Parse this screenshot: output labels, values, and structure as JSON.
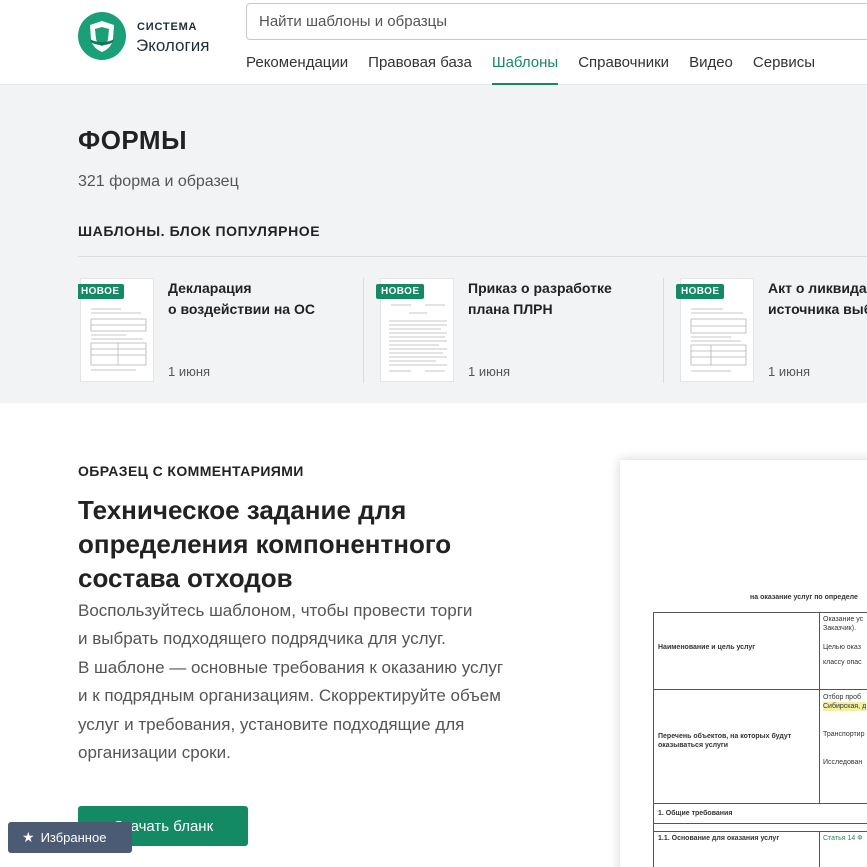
{
  "header": {
    "logo_small": "СИСТЕМА",
    "logo_big": "Экология",
    "search_placeholder": "Найти шаблоны и образцы",
    "nav": [
      "Рекомендации",
      "Правовая база",
      "Шаблоны",
      "Справочники",
      "Видео",
      "Сервисы"
    ],
    "active_nav": "Шаблоны"
  },
  "forms": {
    "title": "ФОРМЫ",
    "count": "321 форма и образец",
    "block_title": "ШАБЛОНЫ. БЛОК ПОПУЛЯРНОЕ",
    "cards": [
      {
        "badge": "НОВОЕ",
        "title_line1": "Декларация",
        "title_line2": "о воздействии на ОС",
        "date": "1 июня"
      },
      {
        "badge": "НОВОЕ",
        "title_line1": "Приказ о разработке",
        "title_line2": "плана ПЛРН",
        "date": "1 июня"
      },
      {
        "badge": "НОВОЕ",
        "title_line1": "Акт о ликвидации",
        "title_line2": "источника выбросов",
        "date": "1 июня"
      }
    ]
  },
  "sample": {
    "label": "ОБРАЗЕЦ С КОММЕНТАРИЯМИ",
    "title_lines": [
      "Техническое задание для",
      "определения компонентного",
      "состава отходов"
    ],
    "desc_lines": [
      "Воспользуйтесь шаблоном, чтобы провести торги",
      "и выбрать подходящего подрядчика для услуг.",
      "В шаблоне — основные требования к оказанию услуг",
      "и к подрядным организациям. Скорректируйте объем",
      "услуг и требования, установите подходящие для",
      "организации сроки."
    ],
    "download_label": "Скачать бланк"
  },
  "favorites_label": "Избранное",
  "preview": {
    "heading": "на оказание услуг по определе",
    "row1_label": "Наименование и цель услуг",
    "row1_value_a": "Оказание ус",
    "row1_value_b": "Заказчик).",
    "row1_value_c": "Целью оказ",
    "row1_value_d": "классу опас",
    "row2_label_a": "Перечень объектов, на которых будут",
    "row2_label_b": "оказываться услуги",
    "row2_value_a": "Отбор проб",
    "row2_value_b": "Сибирская, д",
    "row2_value_c": "Транспортир",
    "row2_value_d": "Исследован",
    "row3_label": "1. Общие требования",
    "row4_label": "1.1. Основание для оказания услуг",
    "row4_value": "Статья 14 Ф"
  },
  "colors": {
    "accent": "#138a63",
    "band": "#f2f3f5",
    "favorites_bg": "#4b5b74"
  }
}
